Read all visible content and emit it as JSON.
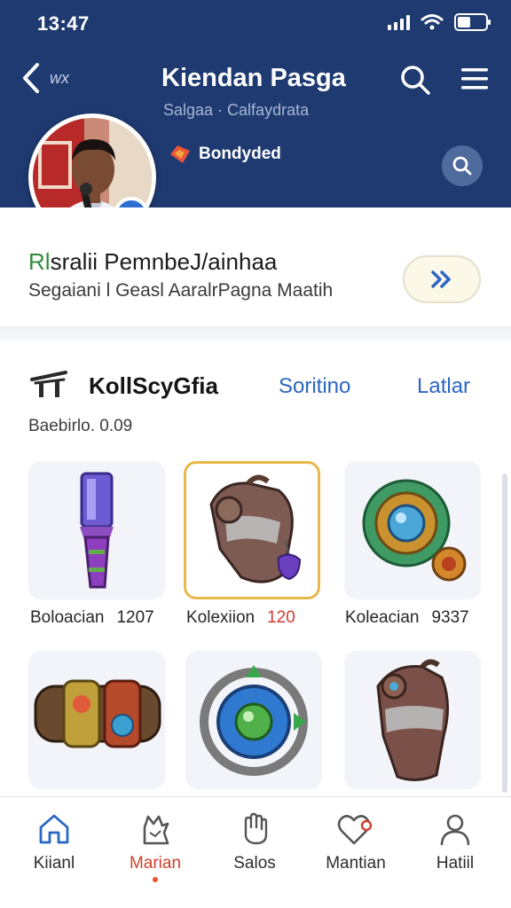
{
  "status_bar": {
    "time": "13:47"
  },
  "header": {
    "back_label": "wx",
    "title": "Kiendan Pasga",
    "subtitle": "Salgaa · Calfaydrata",
    "brand_label": "Bondyded"
  },
  "profile": {
    "name_first": "Rl",
    "name_rest": "sralii PemnbeJ/ainhaa",
    "description": "Segaiani l Geasl AaralrPagna Maatih"
  },
  "collection": {
    "title": "KollScyGfia",
    "tabs": [
      "Soritino",
      "Latlar"
    ],
    "subtitle": "Baebirlo. 0.09",
    "items": [
      {
        "name": "Boloacian",
        "value": "1207"
      },
      {
        "name": "Kolexiion",
        "value": "120"
      },
      {
        "name": "Koleacian",
        "value": "9337"
      },
      {
        "name": "",
        "value": ""
      },
      {
        "name": "",
        "value": ""
      },
      {
        "name": "",
        "value": ""
      }
    ]
  },
  "bottom_nav": [
    {
      "label": "Kiianl",
      "icon": "home-icon"
    },
    {
      "label": "Marian",
      "icon": "cat-icon",
      "active": true
    },
    {
      "label": "Salos",
      "icon": "hand-icon"
    },
    {
      "label": "Mantian",
      "icon": "heart-icon"
    },
    {
      "label": "Hatiil",
      "icon": "person-icon"
    }
  ],
  "colors": {
    "header_bg": "#1e3a70",
    "accent_blue": "#2a66c4",
    "active_red": "#d1402a",
    "selected_border": "#e8b84a"
  }
}
